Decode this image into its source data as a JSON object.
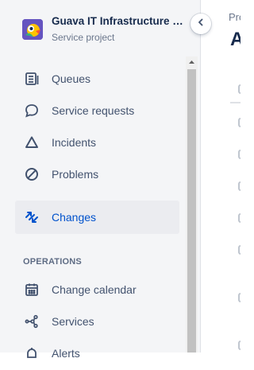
{
  "project": {
    "name": "Guava IT Infrastructure and Operations",
    "type": "Service project"
  },
  "sidebar": {
    "items": [
      {
        "label": "Queues",
        "icon": "queues-icon"
      },
      {
        "label": "Service requests",
        "icon": "speech-bubble-icon"
      },
      {
        "label": "Incidents",
        "icon": "triangle-icon"
      },
      {
        "label": "Problems",
        "icon": "prohibited-icon"
      },
      {
        "label": "Changes",
        "icon": "changes-arrows-icon",
        "selected": true
      }
    ],
    "operations_heading": "OPERATIONS",
    "operations_items": [
      {
        "label": "Change calendar",
        "icon": "calendar-icon"
      },
      {
        "label": "Services",
        "icon": "services-icon"
      },
      {
        "label": "Alerts",
        "icon": "alerts-icon"
      }
    ]
  },
  "main": {
    "breadcrumb": "Pro",
    "title": "A"
  },
  "colors": {
    "accent": "#0052cc",
    "sidebar_bg": "#f4f5f7",
    "selected_bg": "#ebecf0",
    "text": "#42526e"
  }
}
